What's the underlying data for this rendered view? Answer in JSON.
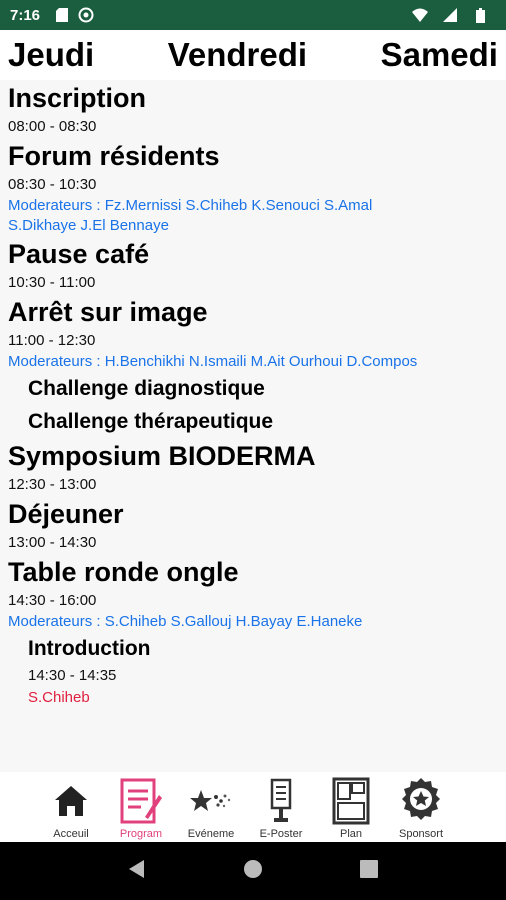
{
  "status_bar": {
    "time": "7:16"
  },
  "day_tabs": [
    {
      "label": "Jeudi"
    },
    {
      "label": "Vendredi"
    },
    {
      "label": "Samedi"
    }
  ],
  "sessions": [
    {
      "title": "Inscription",
      "time": "08:00 - 08:30"
    },
    {
      "title": "Forum résidents",
      "time": "08:30 - 10:30",
      "moderators_line1": "Moderateurs : Fz.Mernissi S.Chiheb K.Senouci S.Amal",
      "moderators_line2": "S.Dikhaye J.El Bennaye"
    },
    {
      "title": "Pause café",
      "time": "10:30 - 11:00"
    },
    {
      "title": "Arrêt sur image",
      "time": "11:00 - 12:30",
      "moderators_line1": "Moderateurs : H.Benchikhi N.Ismaili M.Ait Ourhoui D.Compos",
      "subs": [
        "Challenge diagnostique",
        "Challenge thérapeutique"
      ]
    },
    {
      "title": "Symposium BIODERMA",
      "time": "12:30 - 13:00"
    },
    {
      "title": "Déjeuner",
      "time": "13:00 - 14:30"
    },
    {
      "title": "Table ronde ongle",
      "time": "14:30 - 16:00",
      "moderators_line1": "Moderateurs : S.Chiheb S.Gallouj H.Bayay E.Haneke",
      "sub_title": "Introduction",
      "sub_time": "14:30 - 14:35",
      "sub_speaker": "S.Chiheb"
    }
  ],
  "bottom_nav": [
    {
      "label": "Acceuil",
      "icon": "home-icon",
      "active": false
    },
    {
      "label": "Program",
      "icon": "program-icon",
      "active": true
    },
    {
      "label": "Evéneme",
      "icon": "events-icon",
      "active": false
    },
    {
      "label": "E-Poster",
      "icon": "eposter-icon",
      "active": false
    },
    {
      "label": "Plan",
      "icon": "plan-icon",
      "active": false
    },
    {
      "label": "Sponsort",
      "icon": "sponsor-icon",
      "active": false
    }
  ],
  "colors": {
    "status_bar": "#1b5e3f",
    "moderator_text": "#1a73e8",
    "speaker_text": "#e02040",
    "active_nav": "#e0407b"
  }
}
